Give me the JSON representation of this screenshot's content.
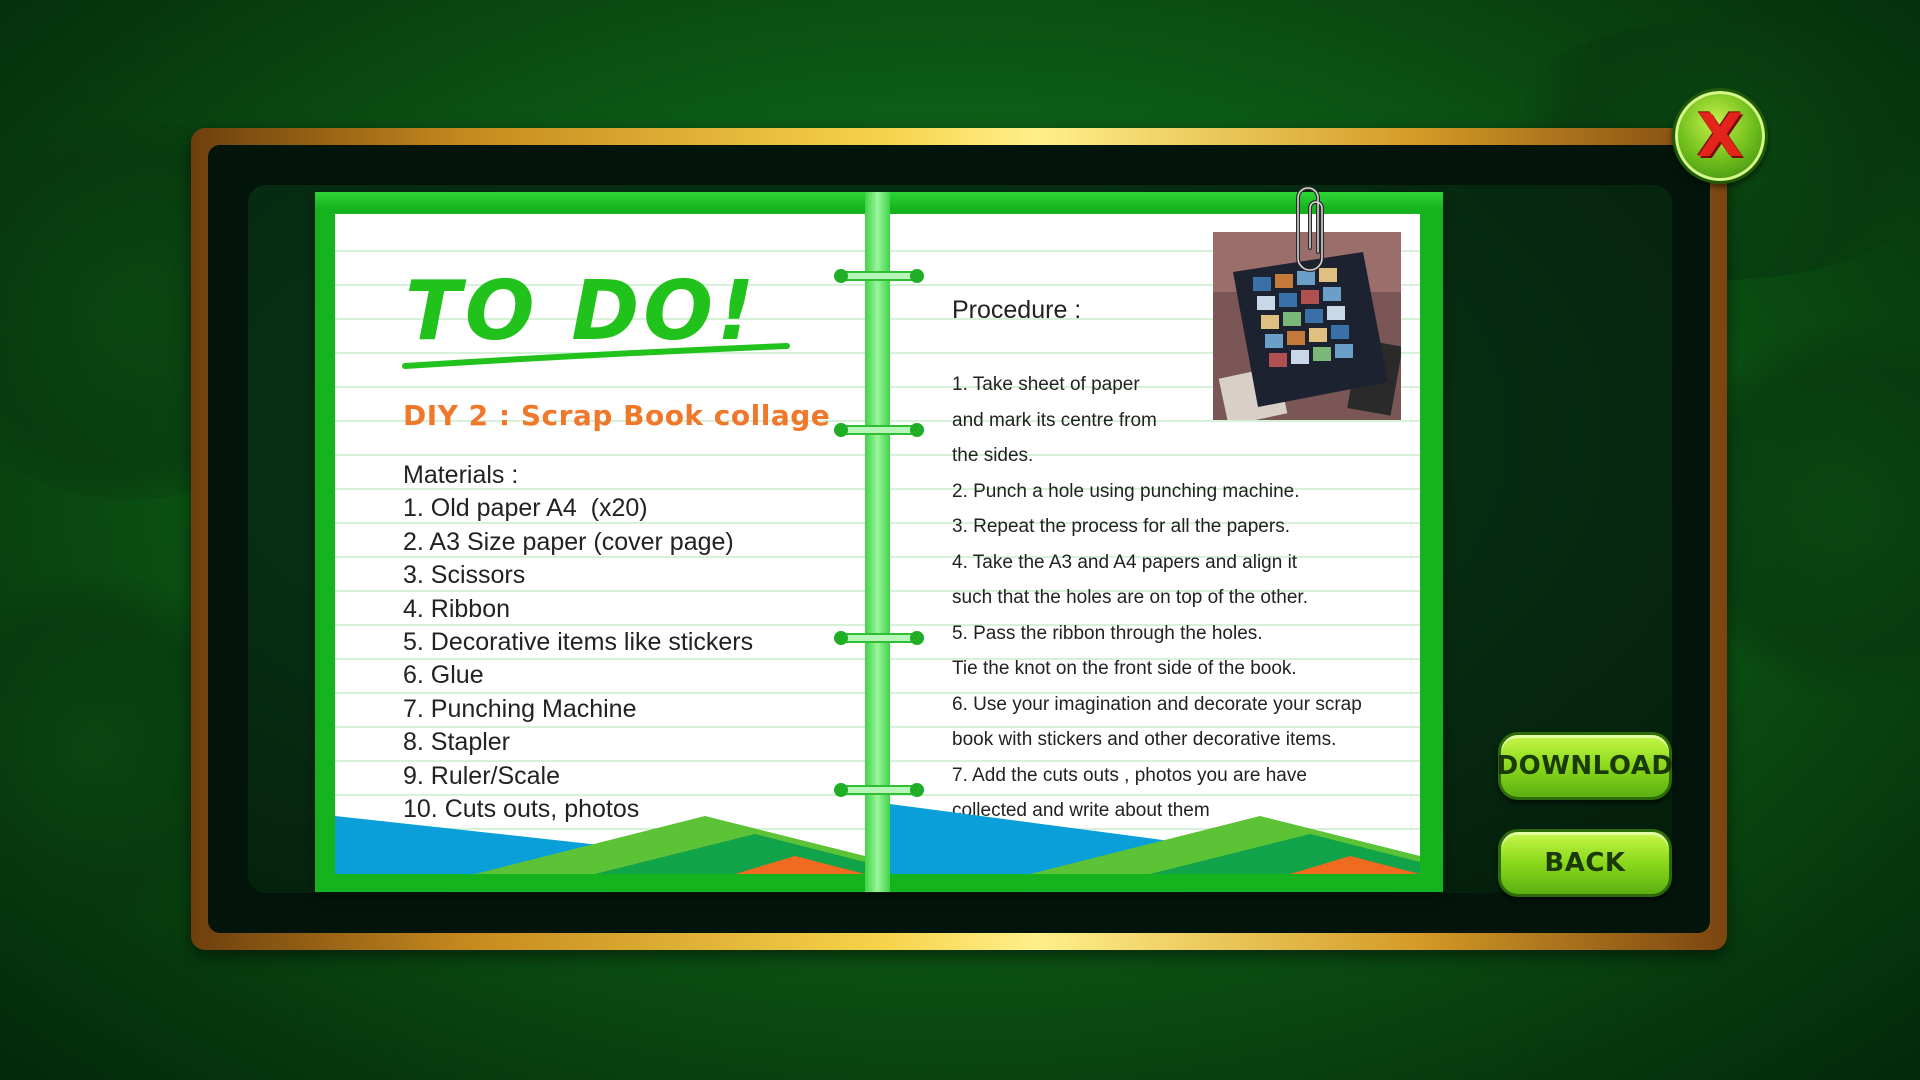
{
  "left_page": {
    "todo_title": "TO DO!",
    "diy_title": "DIY 2 : Scrap Book collage",
    "materials_heading": "Materials :",
    "materials": [
      "1. Old paper A4  (x20)",
      "2. A3 Size paper (cover page)",
      "3. Scissors",
      "4. Ribbon",
      "5. Decorative items like stickers",
      "6. Glue",
      "7. Punching Machine",
      "8. Stapler",
      "9. Ruler/Scale",
      "10. Cuts outs, photos"
    ]
  },
  "right_page": {
    "procedure_heading": "Procedure :",
    "steps": [
      "1. Take sheet of paper",
      "and mark its centre from",
      "the sides.",
      "2. Punch a hole using punching machine.",
      "3. Repeat the process for all the papers.",
      "4. Take the A3 and A4 papers and align it",
      "such that the holes are on top of the other.",
      "5. Pass the ribbon through the holes.",
      "Tie the knot on the front side of the book.",
      "6. Use your imagination and decorate your scrap",
      "book with stickers and other decorative items.",
      "7. Add the cuts outs , photos you are have",
      "collected and write about them"
    ]
  },
  "buttons": {
    "download": "DOWNLOAD",
    "back": "BACK",
    "close_symbol": "X"
  },
  "icons": {
    "close": "close-x-icon",
    "clip": "paperclip-icon",
    "photo": "scrapbook-photo-image"
  },
  "colors": {
    "accent_orange": "#f0782a",
    "notebook_green": "#15b41e",
    "todo_green": "#22c21c",
    "close_red": "#e3241b"
  }
}
